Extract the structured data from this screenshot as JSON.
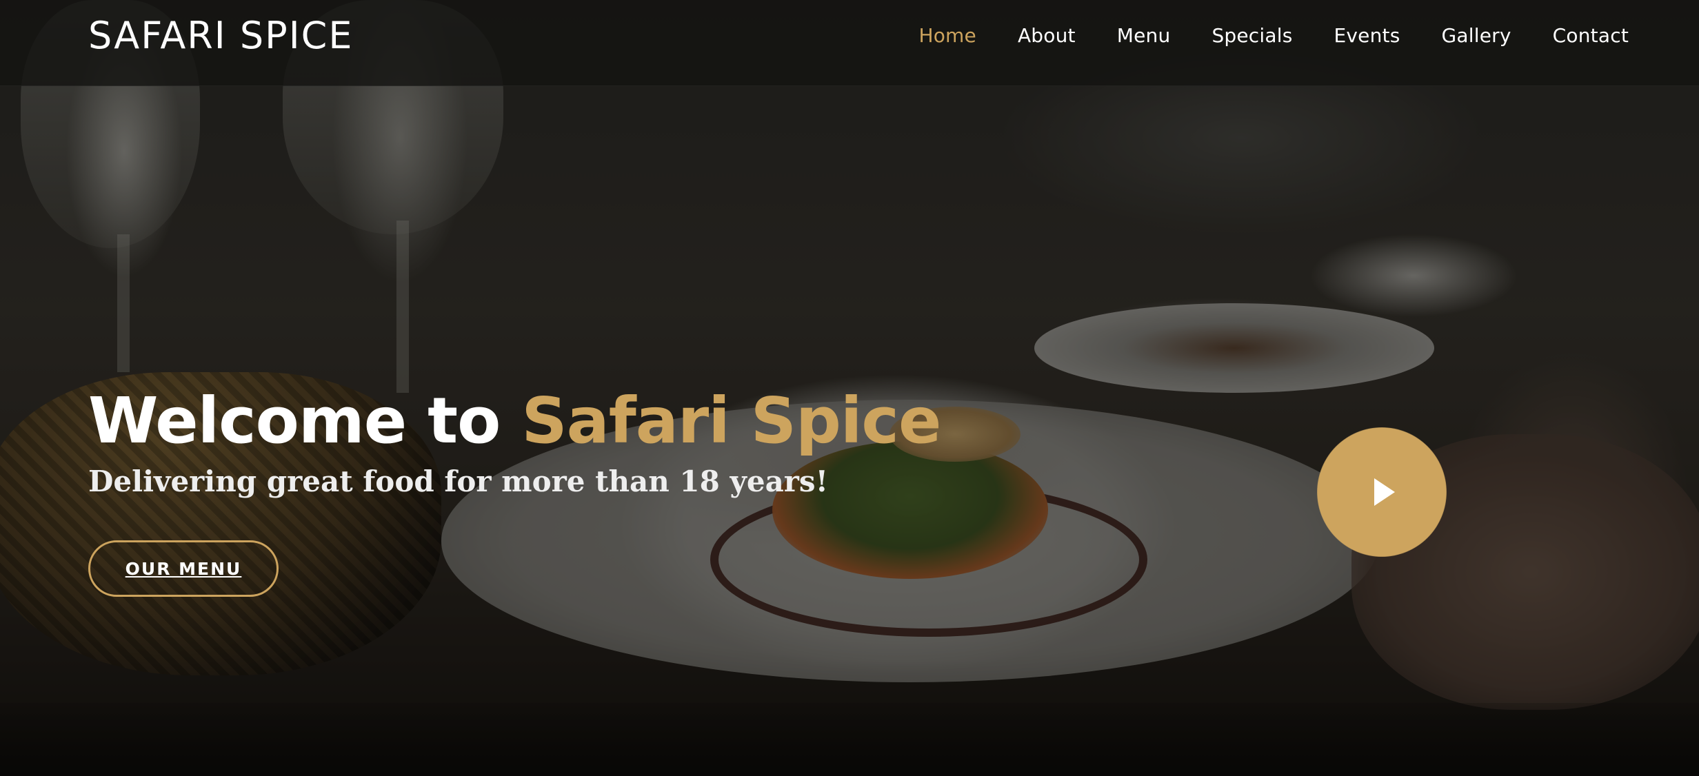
{
  "header": {
    "brand": "SAFARI SPICE",
    "nav": [
      {
        "label": "Home",
        "active": true
      },
      {
        "label": "About",
        "active": false
      },
      {
        "label": "Menu",
        "active": false
      },
      {
        "label": "Specials",
        "active": false
      },
      {
        "label": "Events",
        "active": false
      },
      {
        "label": "Gallery",
        "active": false
      },
      {
        "label": "Contact",
        "active": false
      }
    ]
  },
  "hero": {
    "title_prefix": "Welcome to ",
    "title_accent": "Safari Spice",
    "subtitle": "Delivering great food for more than 18 years!",
    "menu_button": "OUR MENU",
    "play_icon": "play-icon"
  },
  "colors": {
    "accent": "#cda45e",
    "header_bg": "#141311",
    "text": "#ffffff"
  }
}
